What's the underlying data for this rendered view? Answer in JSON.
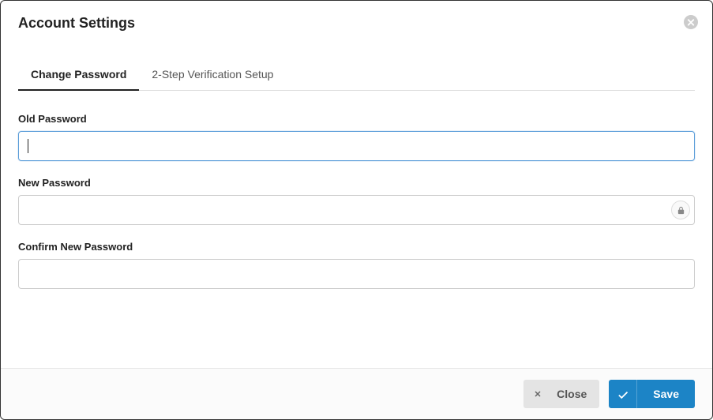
{
  "header": {
    "title": "Account Settings"
  },
  "tabs": {
    "change_password": "Change Password",
    "two_step": "2-Step Verification Setup"
  },
  "form": {
    "old_password": {
      "label": "Old Password",
      "value": ""
    },
    "new_password": {
      "label": "New Password",
      "value": ""
    },
    "confirm_password": {
      "label": "Confirm New Password",
      "value": ""
    }
  },
  "footer": {
    "close": "Close",
    "save": "Save"
  },
  "icons": {
    "close_x": "close-circle",
    "lock": "lock",
    "x_small": "x",
    "check": "check"
  }
}
